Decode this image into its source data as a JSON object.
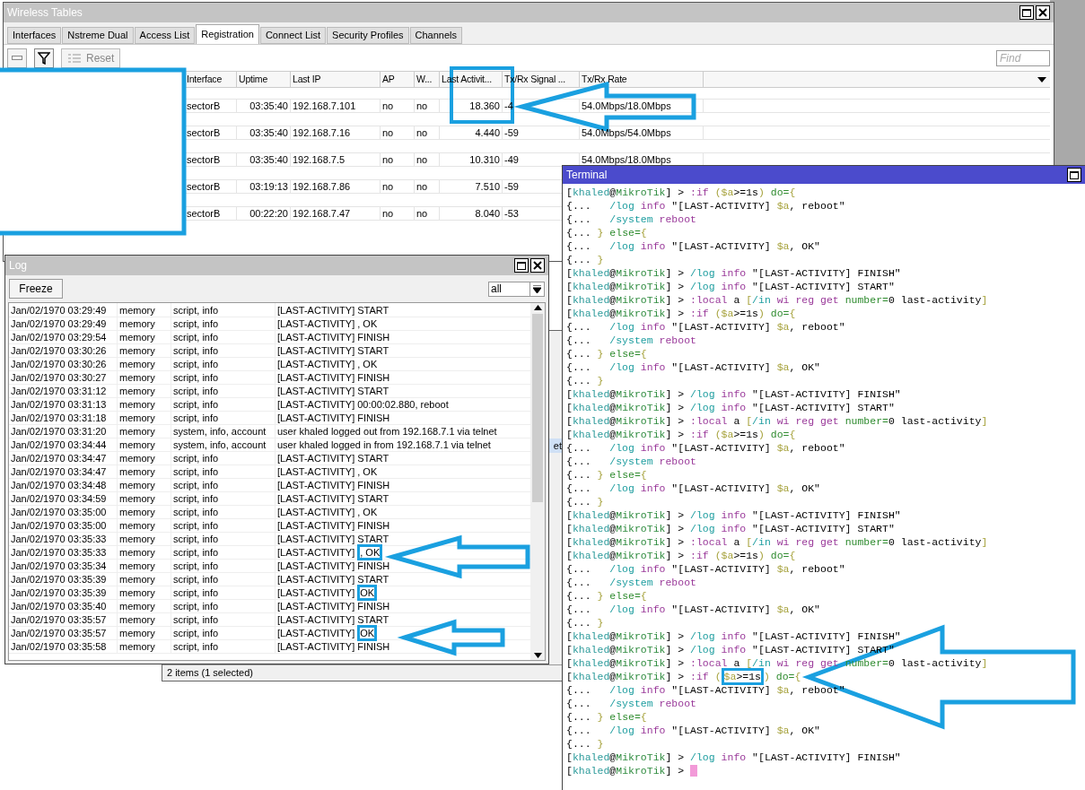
{
  "wireless_tables": {
    "title": "Wireless Tables",
    "tabs": [
      {
        "label": "Interfaces",
        "selected": false
      },
      {
        "label": "Nstreme Dual",
        "selected": false
      },
      {
        "label": "Access List",
        "selected": false
      },
      {
        "label": "Registration",
        "selected": true
      },
      {
        "label": "Connect List",
        "selected": false
      },
      {
        "label": "Security Profiles",
        "selected": false
      },
      {
        "label": "Channels",
        "selected": false
      }
    ],
    "reset": {
      "label": "Reset",
      "disabled": true
    },
    "find": {
      "placeholder": "Find"
    },
    "columns": [
      "Interface",
      "Uptime",
      "Last IP",
      "AP",
      "W...",
      "Last Activit...",
      "Tx/Rx Signal ...",
      "Tx/Rx Rate"
    ],
    "rows": [
      {
        "interface": "sectorB",
        "uptime": "03:35:40",
        "last_ip": "192.168.7.101",
        "ap": "no",
        "w": "no",
        "last_activity": "18.360",
        "signal": "-4",
        "rate": "54.0Mbps/18.0Mbps"
      },
      {
        "interface": "sectorB",
        "uptime": "03:35:40",
        "last_ip": "192.168.7.16",
        "ap": "no",
        "w": "no",
        "last_activity": "4.440",
        "signal": "-59",
        "rate": "54.0Mbps/54.0Mbps"
      },
      {
        "interface": "sectorB",
        "uptime": "03:35:40",
        "last_ip": "192.168.7.5",
        "ap": "no",
        "w": "no",
        "last_activity": "10.310",
        "signal": "-49",
        "rate": "54.0Mbps/18.0Mbps"
      },
      {
        "interface": "sectorB",
        "uptime": "03:19:13",
        "last_ip": "192.168.7.86",
        "ap": "no",
        "w": "no",
        "last_activity": "7.510",
        "signal": "-59"
      },
      {
        "interface": "sectorB",
        "uptime": "00:22:20",
        "last_ip": "192.168.7.47",
        "ap": "no",
        "w": "no",
        "last_activity": "8.040",
        "signal": "-53"
      }
    ]
  },
  "behind_window": {
    "cell": "et",
    "status": "2 items (1 selected)"
  },
  "log": {
    "title": "Log",
    "freeze": "Freeze",
    "filter": "all",
    "rows": [
      {
        "time": "Jan/02/1970 03:29:49",
        "buffer": "memory",
        "topics": "script, info",
        "message": "[LAST-ACTIVITY] START"
      },
      {
        "time": "Jan/02/1970 03:29:49",
        "buffer": "memory",
        "topics": "script, info",
        "message": "[LAST-ACTIVITY] , OK"
      },
      {
        "time": "Jan/02/1970 03:29:54",
        "buffer": "memory",
        "topics": "script, info",
        "message": "[LAST-ACTIVITY] FINISH"
      },
      {
        "time": "Jan/02/1970 03:30:26",
        "buffer": "memory",
        "topics": "script, info",
        "message": "[LAST-ACTIVITY] START"
      },
      {
        "time": "Jan/02/1970 03:30:26",
        "buffer": "memory",
        "topics": "script, info",
        "message": "[LAST-ACTIVITY] , OK"
      },
      {
        "time": "Jan/02/1970 03:30:27",
        "buffer": "memory",
        "topics": "script, info",
        "message": "[LAST-ACTIVITY] FINISH"
      },
      {
        "time": "Jan/02/1970 03:31:12",
        "buffer": "memory",
        "topics": "script, info",
        "message": "[LAST-ACTIVITY] START"
      },
      {
        "time": "Jan/02/1970 03:31:13",
        "buffer": "memory",
        "topics": "script, info",
        "message": "[LAST-ACTIVITY] 00:00:02.880, reboot"
      },
      {
        "time": "Jan/02/1970 03:31:18",
        "buffer": "memory",
        "topics": "script, info",
        "message": "[LAST-ACTIVITY] FINISH"
      },
      {
        "time": "Jan/02/1970 03:31:20",
        "buffer": "memory",
        "topics": "system, info, account",
        "message": "user khaled logged out from 192.168.7.1 via telnet"
      },
      {
        "time": "Jan/02/1970 03:34:44",
        "buffer": "memory",
        "topics": "system, info, account",
        "message": "user khaled logged in from 192.168.7.1 via telnet"
      },
      {
        "time": "Jan/02/1970 03:34:47",
        "buffer": "memory",
        "topics": "script, info",
        "message": "[LAST-ACTIVITY] START"
      },
      {
        "time": "Jan/02/1970 03:34:47",
        "buffer": "memory",
        "topics": "script, info",
        "message": "[LAST-ACTIVITY] , OK"
      },
      {
        "time": "Jan/02/1970 03:34:48",
        "buffer": "memory",
        "topics": "script, info",
        "message": "[LAST-ACTIVITY] FINISH"
      },
      {
        "time": "Jan/02/1970 03:34:59",
        "buffer": "memory",
        "topics": "script, info",
        "message": "[LAST-ACTIVITY] START"
      },
      {
        "time": "Jan/02/1970 03:35:00",
        "buffer": "memory",
        "topics": "script, info",
        "message": "[LAST-ACTIVITY] , OK"
      },
      {
        "time": "Jan/02/1970 03:35:00",
        "buffer": "memory",
        "topics": "script, info",
        "message": "[LAST-ACTIVITY] FINISH"
      },
      {
        "time": "Jan/02/1970 03:35:33",
        "buffer": "memory",
        "topics": "script, info",
        "message": "[LAST-ACTIVITY] START"
      },
      {
        "time": "Jan/02/1970 03:35:33",
        "buffer": "memory",
        "topics": "script, info",
        "message": "[LAST-ACTIVITY] ",
        "highlight": ", OK"
      },
      {
        "time": "Jan/02/1970 03:35:34",
        "buffer": "memory",
        "topics": "script, info",
        "message": "[LAST-ACTIVITY] FINISH"
      },
      {
        "time": "Jan/02/1970 03:35:39",
        "buffer": "memory",
        "topics": "script, info",
        "message": "[LAST-ACTIVITY] START"
      },
      {
        "time": "Jan/02/1970 03:35:39",
        "buffer": "memory",
        "topics": "script, info",
        "message": "[LAST-ACTIVITY] ",
        "highlight": "OK"
      },
      {
        "time": "Jan/02/1970 03:35:40",
        "buffer": "memory",
        "topics": "script, info",
        "message": "[LAST-ACTIVITY] FINISH"
      },
      {
        "time": "Jan/02/1970 03:35:57",
        "buffer": "memory",
        "topics": "script, info",
        "message": "[LAST-ACTIVITY] START"
      },
      {
        "time": "Jan/02/1970 03:35:57",
        "buffer": "memory",
        "topics": "script, info",
        "message": "[LAST-ACTIVITY] ",
        "highlight": "OK"
      },
      {
        "time": "Jan/02/1970 03:35:58",
        "buffer": "memory",
        "topics": "script, info",
        "message": "[LAST-ACTIVITY] FINISH"
      }
    ]
  },
  "terminal": {
    "title": "Terminal",
    "cursor": true,
    "lines": [
      [
        {
          "text": "[",
          "kind": "plain"
        },
        {
          "text": "khaled",
          "kind": "user"
        },
        {
          "text": "@",
          "kind": "plain"
        },
        {
          "text": "MikroTik",
          "kind": "host"
        },
        {
          "text": "] > ",
          "kind": "plain"
        },
        {
          "text": ":if ",
          "kind": "command"
        },
        {
          "text": "($a",
          "kind": "operator"
        },
        {
          "text": ">=1s",
          "kind": "plain"
        },
        {
          "text": ") ",
          "kind": "operator"
        },
        {
          "text": "do=",
          "kind": "keyword"
        },
        {
          "text": "{",
          "kind": "operator"
        }
      ],
      [
        {
          "text": "{...   ",
          "kind": "plain"
        },
        {
          "text": "/log ",
          "kind": "path"
        },
        {
          "text": "info ",
          "kind": "command"
        },
        {
          "text": "\"[LAST-ACTIVITY] ",
          "kind": "plain"
        },
        {
          "text": "$a",
          "kind": "operator"
        },
        {
          "text": ", reboot\"",
          "kind": "plain"
        }
      ],
      [
        {
          "text": "{...   ",
          "kind": "plain"
        },
        {
          "text": "/system ",
          "kind": "path"
        },
        {
          "text": "reboot",
          "kind": "command"
        }
      ],
      [
        {
          "text": "{... ",
          "kind": "plain"
        },
        {
          "text": "} ",
          "kind": "operator"
        },
        {
          "text": "else=",
          "kind": "keyword"
        },
        {
          "text": "{",
          "kind": "operator"
        }
      ],
      [
        {
          "text": "{...   ",
          "kind": "plain"
        },
        {
          "text": "/log ",
          "kind": "path"
        },
        {
          "text": "info ",
          "kind": "command"
        },
        {
          "text": "\"[LAST-ACTIVITY] ",
          "kind": "plain"
        },
        {
          "text": "$a",
          "kind": "operator"
        },
        {
          "text": ", OK\"",
          "kind": "plain"
        }
      ],
      [
        {
          "text": "{... ",
          "kind": "plain"
        },
        {
          "text": "}",
          "kind": "operator"
        }
      ],
      [
        {
          "text": "[",
          "kind": "plain"
        },
        {
          "text": "khaled",
          "kind": "user"
        },
        {
          "text": "@",
          "kind": "plain"
        },
        {
          "text": "MikroTik",
          "kind": "host"
        },
        {
          "text": "] > ",
          "kind": "plain"
        },
        {
          "text": "/log ",
          "kind": "path"
        },
        {
          "text": "info ",
          "kind": "command"
        },
        {
          "text": "\"[LAST-ACTIVITY] FINISH\"",
          "kind": "plain"
        }
      ],
      [
        {
          "text": "[",
          "kind": "plain"
        },
        {
          "text": "khaled",
          "kind": "user"
        },
        {
          "text": "@",
          "kind": "plain"
        },
        {
          "text": "MikroTik",
          "kind": "host"
        },
        {
          "text": "] > ",
          "kind": "plain"
        },
        {
          "text": "/log ",
          "kind": "path"
        },
        {
          "text": "info ",
          "kind": "command"
        },
        {
          "text": "\"[LAST-ACTIVITY] START\"",
          "kind": "plain"
        }
      ],
      [
        {
          "text": "[",
          "kind": "plain"
        },
        {
          "text": "khaled",
          "kind": "user"
        },
        {
          "text": "@",
          "kind": "plain"
        },
        {
          "text": "MikroTik",
          "kind": "host"
        },
        {
          "text": "] > ",
          "kind": "plain"
        },
        {
          "text": ":local ",
          "kind": "command"
        },
        {
          "text": "a ",
          "kind": "plain"
        },
        {
          "text": "[",
          "kind": "operator"
        },
        {
          "text": "/in ",
          "kind": "path"
        },
        {
          "text": "wi reg get ",
          "kind": "command"
        },
        {
          "text": "number=",
          "kind": "keyword"
        },
        {
          "text": "0 last-activity",
          "kind": "plain"
        },
        {
          "text": "]",
          "kind": "operator"
        }
      ],
      [
        {
          "text": "[",
          "kind": "plain"
        },
        {
          "text": "khaled",
          "kind": "user"
        },
        {
          "text": "@",
          "kind": "plain"
        },
        {
          "text": "MikroTik",
          "kind": "host"
        },
        {
          "text": "] > ",
          "kind": "plain"
        },
        {
          "text": ":if ",
          "kind": "command"
        },
        {
          "text": "($a",
          "kind": "operator"
        },
        {
          "text": ">=1s",
          "kind": "plain"
        },
        {
          "text": ") ",
          "kind": "operator"
        },
        {
          "text": "do=",
          "kind": "keyword"
        },
        {
          "text": "{",
          "kind": "operator"
        }
      ],
      [
        {
          "text": "{...   ",
          "kind": "plain"
        },
        {
          "text": "/log ",
          "kind": "path"
        },
        {
          "text": "info ",
          "kind": "command"
        },
        {
          "text": "\"[LAST-ACTIVITY] ",
          "kind": "plain"
        },
        {
          "text": "$a",
          "kind": "operator"
        },
        {
          "text": ", reboot\"",
          "kind": "plain"
        }
      ],
      [
        {
          "text": "{...   ",
          "kind": "plain"
        },
        {
          "text": "/system ",
          "kind": "path"
        },
        {
          "text": "reboot",
          "kind": "command"
        }
      ],
      [
        {
          "text": "{... ",
          "kind": "plain"
        },
        {
          "text": "} ",
          "kind": "operator"
        },
        {
          "text": "else=",
          "kind": "keyword"
        },
        {
          "text": "{",
          "kind": "operator"
        }
      ],
      [
        {
          "text": "{...   ",
          "kind": "plain"
        },
        {
          "text": "/log ",
          "kind": "path"
        },
        {
          "text": "info ",
          "kind": "command"
        },
        {
          "text": "\"[LAST-ACTIVITY] ",
          "kind": "plain"
        },
        {
          "text": "$a",
          "kind": "operator"
        },
        {
          "text": ", OK\"",
          "kind": "plain"
        }
      ],
      [
        {
          "text": "{... ",
          "kind": "plain"
        },
        {
          "text": "}",
          "kind": "operator"
        }
      ],
      [
        {
          "text": "[",
          "kind": "plain"
        },
        {
          "text": "khaled",
          "kind": "user"
        },
        {
          "text": "@",
          "kind": "plain"
        },
        {
          "text": "MikroTik",
          "kind": "host"
        },
        {
          "text": "] > ",
          "kind": "plain"
        },
        {
          "text": "/log ",
          "kind": "path"
        },
        {
          "text": "info ",
          "kind": "command"
        },
        {
          "text": "\"[LAST-ACTIVITY] FINISH\"",
          "kind": "plain"
        }
      ],
      [
        {
          "text": "[",
          "kind": "plain"
        },
        {
          "text": "khaled",
          "kind": "user"
        },
        {
          "text": "@",
          "kind": "plain"
        },
        {
          "text": "MikroTik",
          "kind": "host"
        },
        {
          "text": "] > ",
          "kind": "plain"
        },
        {
          "text": "/log ",
          "kind": "path"
        },
        {
          "text": "info ",
          "kind": "command"
        },
        {
          "text": "\"[LAST-ACTIVITY] START\"",
          "kind": "plain"
        }
      ],
      [
        {
          "text": "[",
          "kind": "plain"
        },
        {
          "text": "khaled",
          "kind": "user"
        },
        {
          "text": "@",
          "kind": "plain"
        },
        {
          "text": "MikroTik",
          "kind": "host"
        },
        {
          "text": "] > ",
          "kind": "plain"
        },
        {
          "text": ":local ",
          "kind": "command"
        },
        {
          "text": "a ",
          "kind": "plain"
        },
        {
          "text": "[",
          "kind": "operator"
        },
        {
          "text": "/in ",
          "kind": "path"
        },
        {
          "text": "wi reg get ",
          "kind": "command"
        },
        {
          "text": "number=",
          "kind": "keyword"
        },
        {
          "text": "0 last-activity",
          "kind": "plain"
        },
        {
          "text": "]",
          "kind": "operator"
        }
      ],
      [
        {
          "text": "[",
          "kind": "plain"
        },
        {
          "text": "khaled",
          "kind": "user"
        },
        {
          "text": "@",
          "kind": "plain"
        },
        {
          "text": "MikroTik",
          "kind": "host"
        },
        {
          "text": "] > ",
          "kind": "plain"
        },
        {
          "text": ":if ",
          "kind": "command"
        },
        {
          "text": "($a",
          "kind": "operator"
        },
        {
          "text": ">=1s",
          "kind": "plain"
        },
        {
          "text": ") ",
          "kind": "operator"
        },
        {
          "text": "do=",
          "kind": "keyword"
        },
        {
          "text": "{",
          "kind": "operator"
        }
      ],
      [
        {
          "text": "{...   ",
          "kind": "plain"
        },
        {
          "text": "/log ",
          "kind": "path"
        },
        {
          "text": "info ",
          "kind": "command"
        },
        {
          "text": "\"[LAST-ACTIVITY] ",
          "kind": "plain"
        },
        {
          "text": "$a",
          "kind": "operator"
        },
        {
          "text": ", reboot\"",
          "kind": "plain"
        }
      ],
      [
        {
          "text": "{...   ",
          "kind": "plain"
        },
        {
          "text": "/system ",
          "kind": "path"
        },
        {
          "text": "reboot",
          "kind": "command"
        }
      ],
      [
        {
          "text": "{... ",
          "kind": "plain"
        },
        {
          "text": "} ",
          "kind": "operator"
        },
        {
          "text": "else=",
          "kind": "keyword"
        },
        {
          "text": "{",
          "kind": "operator"
        }
      ],
      [
        {
          "text": "{...   ",
          "kind": "plain"
        },
        {
          "text": "/log ",
          "kind": "path"
        },
        {
          "text": "info ",
          "kind": "command"
        },
        {
          "text": "\"[LAST-ACTIVITY] ",
          "kind": "plain"
        },
        {
          "text": "$a",
          "kind": "operator"
        },
        {
          "text": ", OK\"",
          "kind": "plain"
        }
      ],
      [
        {
          "text": "{... ",
          "kind": "plain"
        },
        {
          "text": "}",
          "kind": "operator"
        }
      ],
      [
        {
          "text": "[",
          "kind": "plain"
        },
        {
          "text": "khaled",
          "kind": "user"
        },
        {
          "text": "@",
          "kind": "plain"
        },
        {
          "text": "MikroTik",
          "kind": "host"
        },
        {
          "text": "] > ",
          "kind": "plain"
        },
        {
          "text": "/log ",
          "kind": "path"
        },
        {
          "text": "info ",
          "kind": "command"
        },
        {
          "text": "\"[LAST-ACTIVITY] FINISH\"",
          "kind": "plain"
        }
      ],
      [
        {
          "text": "[",
          "kind": "plain"
        },
        {
          "text": "khaled",
          "kind": "user"
        },
        {
          "text": "@",
          "kind": "plain"
        },
        {
          "text": "MikroTik",
          "kind": "host"
        },
        {
          "text": "] > ",
          "kind": "plain"
        },
        {
          "text": "/log ",
          "kind": "path"
        },
        {
          "text": "info ",
          "kind": "command"
        },
        {
          "text": "\"[LAST-ACTIVITY] START\"",
          "kind": "plain"
        }
      ],
      [
        {
          "text": "[",
          "kind": "plain"
        },
        {
          "text": "khaled",
          "kind": "user"
        },
        {
          "text": "@",
          "kind": "plain"
        },
        {
          "text": "MikroTik",
          "kind": "host"
        },
        {
          "text": "] > ",
          "kind": "plain"
        },
        {
          "text": ":local ",
          "kind": "command"
        },
        {
          "text": "a ",
          "kind": "plain"
        },
        {
          "text": "[",
          "kind": "operator"
        },
        {
          "text": "/in ",
          "kind": "path"
        },
        {
          "text": "wi reg get ",
          "kind": "command"
        },
        {
          "text": "number=",
          "kind": "keyword"
        },
        {
          "text": "0 last-activity",
          "kind": "plain"
        },
        {
          "text": "]",
          "kind": "operator"
        }
      ],
      [
        {
          "text": "[",
          "kind": "plain"
        },
        {
          "text": "khaled",
          "kind": "user"
        },
        {
          "text": "@",
          "kind": "plain"
        },
        {
          "text": "MikroTik",
          "kind": "host"
        },
        {
          "text": "] > ",
          "kind": "plain"
        },
        {
          "text": ":if ",
          "kind": "command"
        },
        {
          "text": "($a",
          "kind": "operator"
        },
        {
          "text": ">=1s",
          "kind": "plain"
        },
        {
          "text": ") ",
          "kind": "operator"
        },
        {
          "text": "do=",
          "kind": "keyword"
        },
        {
          "text": "{",
          "kind": "operator"
        }
      ],
      [
        {
          "text": "{...   ",
          "kind": "plain"
        },
        {
          "text": "/log ",
          "kind": "path"
        },
        {
          "text": "info ",
          "kind": "command"
        },
        {
          "text": "\"[LAST-ACTIVITY] ",
          "kind": "plain"
        },
        {
          "text": "$a",
          "kind": "operator"
        },
        {
          "text": ", reboot\"",
          "kind": "plain"
        }
      ],
      [
        {
          "text": "{...   ",
          "kind": "plain"
        },
        {
          "text": "/system ",
          "kind": "path"
        },
        {
          "text": "reboot",
          "kind": "command"
        }
      ],
      [
        {
          "text": "{... ",
          "kind": "plain"
        },
        {
          "text": "} ",
          "kind": "operator"
        },
        {
          "text": "else=",
          "kind": "keyword"
        },
        {
          "text": "{",
          "kind": "operator"
        }
      ],
      [
        {
          "text": "{...   ",
          "kind": "plain"
        },
        {
          "text": "/log ",
          "kind": "path"
        },
        {
          "text": "info ",
          "kind": "command"
        },
        {
          "text": "\"[LAST-ACTIVITY] ",
          "kind": "plain"
        },
        {
          "text": "$a",
          "kind": "operator"
        },
        {
          "text": ", OK\"",
          "kind": "plain"
        }
      ],
      [
        {
          "text": "{... ",
          "kind": "plain"
        },
        {
          "text": "}",
          "kind": "operator"
        }
      ],
      [
        {
          "text": "[",
          "kind": "plain"
        },
        {
          "text": "khaled",
          "kind": "user"
        },
        {
          "text": "@",
          "kind": "plain"
        },
        {
          "text": "MikroTik",
          "kind": "host"
        },
        {
          "text": "] > ",
          "kind": "plain"
        },
        {
          "text": "/log ",
          "kind": "path"
        },
        {
          "text": "info ",
          "kind": "command"
        },
        {
          "text": "\"[LAST-ACTIVITY] FINISH\"",
          "kind": "plain"
        }
      ],
      [
        {
          "text": "[",
          "kind": "plain"
        },
        {
          "text": "khaled",
          "kind": "user"
        },
        {
          "text": "@",
          "kind": "plain"
        },
        {
          "text": "MikroTik",
          "kind": "host"
        },
        {
          "text": "] > ",
          "kind": "plain"
        },
        {
          "text": "/log ",
          "kind": "path"
        },
        {
          "text": "info ",
          "kind": "command"
        },
        {
          "text": "\"[LAST-ACTIVITY] START\"",
          "kind": "plain"
        }
      ],
      [
        {
          "text": "[",
          "kind": "plain"
        },
        {
          "text": "khaled",
          "kind": "user"
        },
        {
          "text": "@",
          "kind": "plain"
        },
        {
          "text": "MikroTik",
          "kind": "host"
        },
        {
          "text": "] > ",
          "kind": "plain"
        },
        {
          "text": ":local ",
          "kind": "command"
        },
        {
          "text": "a ",
          "kind": "plain"
        },
        {
          "text": "[",
          "kind": "operator"
        },
        {
          "text": "/in ",
          "kind": "path"
        },
        {
          "text": "wi reg get ",
          "kind": "command"
        },
        {
          "text": "number=",
          "kind": "keyword"
        },
        {
          "text": "0 last-activity",
          "kind": "plain"
        },
        {
          "text": "]",
          "kind": "operator"
        }
      ],
      [
        {
          "text": "[",
          "kind": "plain"
        },
        {
          "text": "khaled",
          "kind": "user"
        },
        {
          "text": "@",
          "kind": "plain"
        },
        {
          "text": "MikroTik",
          "kind": "host"
        },
        {
          "text": "] > ",
          "kind": "plain"
        },
        {
          "text": ":if ",
          "kind": "command"
        },
        {
          "text": "(",
          "kind": "operator"
        },
        {
          "text": "$a",
          "kind": "operator",
          "highlighted": true
        },
        {
          "text": ">=1s",
          "kind": "plain",
          "highlighted": true
        },
        {
          "text": ") ",
          "kind": "operator"
        },
        {
          "text": "do=",
          "kind": "keyword"
        },
        {
          "text": "{",
          "kind": "operator"
        }
      ],
      [
        {
          "text": "{...   ",
          "kind": "plain"
        },
        {
          "text": "/log ",
          "kind": "path"
        },
        {
          "text": "info ",
          "kind": "command"
        },
        {
          "text": "\"[LAST-ACTIVITY] ",
          "kind": "plain"
        },
        {
          "text": "$a",
          "kind": "operator"
        },
        {
          "text": ", reboot\"",
          "kind": "plain"
        }
      ],
      [
        {
          "text": "{...   ",
          "kind": "plain"
        },
        {
          "text": "/system ",
          "kind": "path"
        },
        {
          "text": "reboot",
          "kind": "command"
        }
      ],
      [
        {
          "text": "{... ",
          "kind": "plain"
        },
        {
          "text": "} ",
          "kind": "operator"
        },
        {
          "text": "else=",
          "kind": "keyword"
        },
        {
          "text": "{",
          "kind": "operator"
        }
      ],
      [
        {
          "text": "{...   ",
          "kind": "plain"
        },
        {
          "text": "/log ",
          "kind": "path"
        },
        {
          "text": "info ",
          "kind": "command"
        },
        {
          "text": "\"[LAST-ACTIVITY] ",
          "kind": "plain"
        },
        {
          "text": "$a",
          "kind": "operator"
        },
        {
          "text": ", OK\"",
          "kind": "plain"
        }
      ],
      [
        {
          "text": "{... ",
          "kind": "plain"
        },
        {
          "text": "}",
          "kind": "operator"
        }
      ],
      [
        {
          "text": "[",
          "kind": "plain"
        },
        {
          "text": "khaled",
          "kind": "user"
        },
        {
          "text": "@",
          "kind": "plain"
        },
        {
          "text": "MikroTik",
          "kind": "host"
        },
        {
          "text": "] > ",
          "kind": "plain"
        },
        {
          "text": "/log ",
          "kind": "path"
        },
        {
          "text": "info ",
          "kind": "command"
        },
        {
          "text": "\"[LAST-ACTIVITY] FINISH\"",
          "kind": "plain"
        }
      ],
      [
        {
          "text": "[",
          "kind": "plain"
        },
        {
          "text": "khaled",
          "kind": "user"
        },
        {
          "text": "@",
          "kind": "plain"
        },
        {
          "text": "MikroTik",
          "kind": "host"
        },
        {
          "text": "] > ",
          "kind": "plain"
        }
      ]
    ]
  }
}
